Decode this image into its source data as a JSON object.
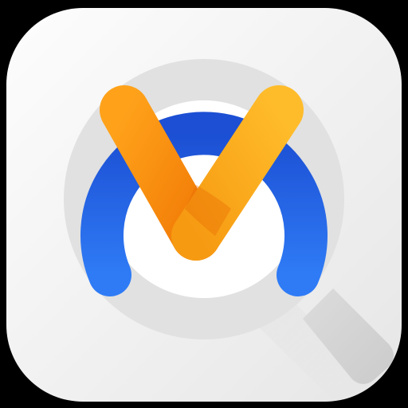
{
  "icon": {
    "name": "magnifier-m-app-icon",
    "colors": {
      "background": "#000000",
      "tile_light": "#fbfbfb",
      "tile_dark": "#e4e4e4",
      "lens_ring": "#e2e2e2",
      "handle": "#d4d4d4",
      "arc_blue_top": "#1f58d9",
      "arc_blue_bottom": "#2f7af5",
      "check_orange_light": "#ffb21f",
      "check_orange_dark": "#f47a08"
    }
  }
}
